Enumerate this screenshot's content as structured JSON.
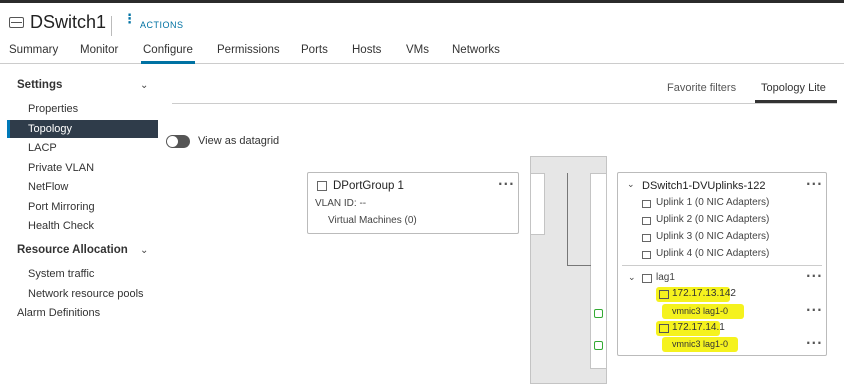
{
  "header": {
    "title": "DSwitch1",
    "actions_label": "ACTIONS"
  },
  "tabs": [
    "Summary",
    "Monitor",
    "Configure",
    "Permissions",
    "Ports",
    "Hosts",
    "VMs",
    "Networks"
  ],
  "active_tab": "Configure",
  "sidebar": {
    "settings_label": "Settings",
    "settings_items": [
      "Properties",
      "Topology",
      "LACP",
      "Private VLAN",
      "NetFlow",
      "Port Mirroring",
      "Health Check"
    ],
    "selected_item": "Topology",
    "resource_label": "Resource Allocation",
    "resource_items": [
      "System traffic",
      "Network resource pools"
    ],
    "alarm_label": "Alarm Definitions"
  },
  "toolbar": {
    "favorite_filters": "Favorite filters",
    "topology_lite": "Topology Lite"
  },
  "toggle": {
    "label": "View as datagrid",
    "on": false
  },
  "portgroup": {
    "name": "DPortGroup 1",
    "vlan": "VLAN ID: --",
    "vms": "Virtual Machines (0)",
    "more": "···"
  },
  "uplinks": {
    "name": "DSwitch1-DVUplinks-122",
    "more": "···",
    "items": [
      "Uplink 1 (0 NIC Adapters)",
      "Uplink 2 (0 NIC Adapters)",
      "Uplink 3 (0 NIC Adapters)",
      "Uplink 4 (0 NIC Adapters)"
    ],
    "lag": "lag1",
    "lag_more": "···",
    "hosts": [
      {
        "ip": "172.17.13.142",
        "nic": "vmnic3 lag1-0",
        "more": "···"
      },
      {
        "ip": "172.17.14.1",
        "nic": "vmnic3 lag1-0",
        "more": "···"
      }
    ]
  },
  "colors": {
    "accent": "#0072a3",
    "highlight": "#f5f21e",
    "selected_bg": "#2f3c4a"
  }
}
